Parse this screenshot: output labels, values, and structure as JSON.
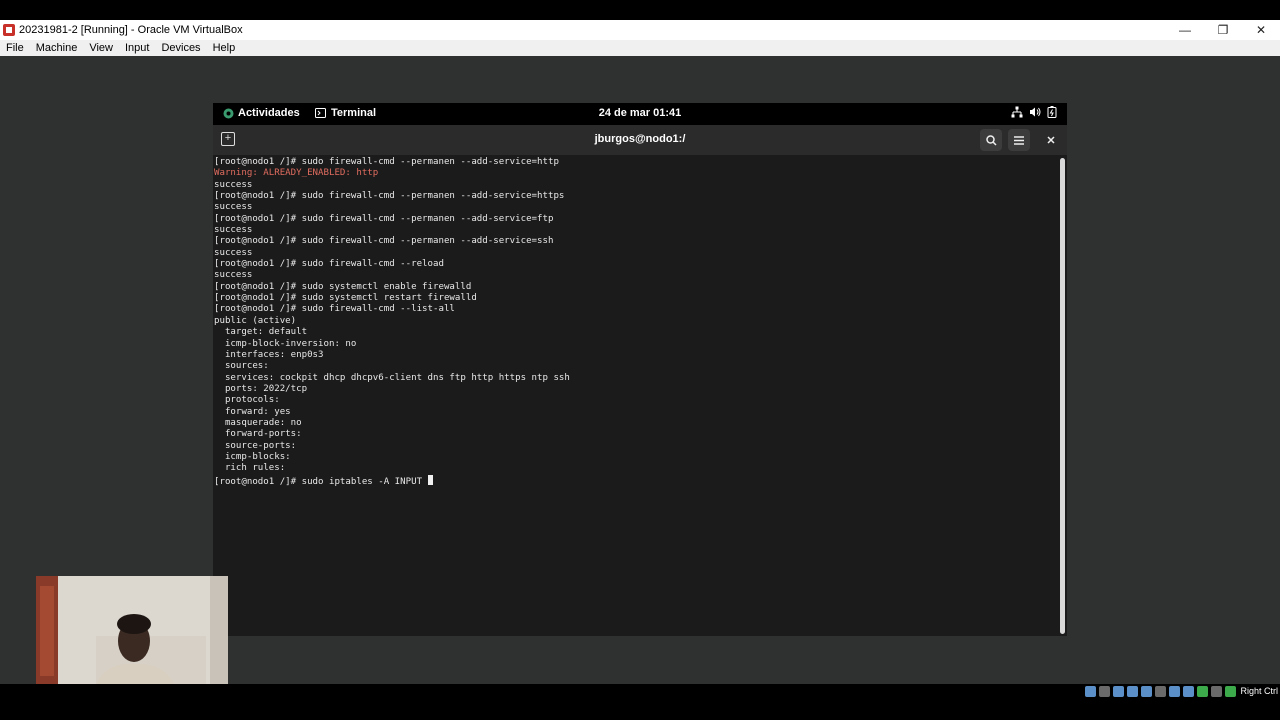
{
  "window": {
    "title": "20231981-2 [Running] - Oracle VM VirtualBox",
    "controls": {
      "minimize": "—",
      "restore": "❐",
      "close": "✕"
    }
  },
  "menu": {
    "items": [
      "File",
      "Machine",
      "View",
      "Input",
      "Devices",
      "Help"
    ]
  },
  "gnome_bar": {
    "activities": "Actividades",
    "app": "Terminal",
    "clock": "24 de mar  01:41",
    "tray_icons": [
      "network-icon",
      "volume-icon",
      "battery-icon"
    ]
  },
  "terminal": {
    "title": "jburgos@nodo1:/",
    "lines": [
      {
        "text": "[root@nodo1 /]# sudo firewall-cmd --permanen --add-service=http",
        "style": "normal"
      },
      {
        "text": "Warning: ALREADY_ENABLED: http",
        "style": "warn"
      },
      {
        "text": "success",
        "style": "normal"
      },
      {
        "text": "[root@nodo1 /]# sudo firewall-cmd --permanen --add-service=https",
        "style": "normal"
      },
      {
        "text": "success",
        "style": "normal"
      },
      {
        "text": "[root@nodo1 /]# sudo firewall-cmd --permanen --add-service=ftp",
        "style": "normal"
      },
      {
        "text": "success",
        "style": "normal"
      },
      {
        "text": "[root@nodo1 /]# sudo firewall-cmd --permanen --add-service=ssh",
        "style": "normal"
      },
      {
        "text": "success",
        "style": "normal"
      },
      {
        "text": "[root@nodo1 /]# sudo firewall-cmd --reload",
        "style": "normal"
      },
      {
        "text": "success",
        "style": "normal"
      },
      {
        "text": "[root@nodo1 /]# sudo systemctl enable firewalld",
        "style": "normal"
      },
      {
        "text": "[root@nodo1 /]# sudo systemctl restart firewalld",
        "style": "normal"
      },
      {
        "text": "[root@nodo1 /]# sudo firewall-cmd --list-all",
        "style": "normal"
      },
      {
        "text": "public (active)",
        "style": "normal"
      },
      {
        "text": "  target: default",
        "style": "normal"
      },
      {
        "text": "  icmp-block-inversion: no",
        "style": "normal"
      },
      {
        "text": "  interfaces: enp0s3",
        "style": "normal"
      },
      {
        "text": "  sources: ",
        "style": "normal"
      },
      {
        "text": "  services: cockpit dhcp dhcpv6-client dns ftp http https ntp ssh",
        "style": "normal"
      },
      {
        "text": "  ports: 2022/tcp",
        "style": "normal"
      },
      {
        "text": "  protocols: ",
        "style": "normal"
      },
      {
        "text": "  forward: yes",
        "style": "normal"
      },
      {
        "text": "  masquerade: no",
        "style": "normal"
      },
      {
        "text": "  forward-ports: ",
        "style": "normal"
      },
      {
        "text": "  source-ports: ",
        "style": "normal"
      },
      {
        "text": "  icmp-blocks: ",
        "style": "normal"
      },
      {
        "text": "  rich rules: ",
        "style": "normal"
      }
    ],
    "current_prompt": "[root@nodo1 /]# sudo iptables -A INPUT "
  },
  "status_bar": {
    "host_key": "Right Ctrl"
  },
  "colors": {
    "warning": "#e06c5f",
    "terminal_bg": "#1b1b1b",
    "vm_bg": "#2f3130"
  }
}
